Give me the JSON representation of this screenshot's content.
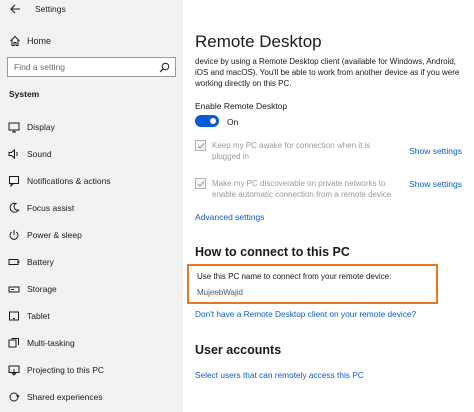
{
  "window": {
    "title": "Settings"
  },
  "sidebar": {
    "home_label": "Home",
    "search_placeholder": "Find a setting",
    "section": "System",
    "items": [
      {
        "label": "Display",
        "icon": "display-icon"
      },
      {
        "label": "Sound",
        "icon": "sound-icon"
      },
      {
        "label": "Notifications & actions",
        "icon": "notifications-icon"
      },
      {
        "label": "Focus assist",
        "icon": "focus-assist-icon"
      },
      {
        "label": "Power & sleep",
        "icon": "power-icon"
      },
      {
        "label": "Battery",
        "icon": "battery-icon"
      },
      {
        "label": "Storage",
        "icon": "storage-icon"
      },
      {
        "label": "Tablet",
        "icon": "tablet-icon"
      },
      {
        "label": "Multi-tasking",
        "icon": "multitasking-icon"
      },
      {
        "label": "Projecting to this PC",
        "icon": "projecting-icon"
      },
      {
        "label": "Shared experiences",
        "icon": "shared-experiences-icon"
      }
    ]
  },
  "main": {
    "title": "Remote Desktop",
    "description": "device by using a Remote Desktop client (available for Windows, Android, iOS and macOS). You'll be able to work from another device as if you were working directly on this PC.",
    "enable_label": "Enable Remote Desktop",
    "toggle_state": "On",
    "toggle_on": true,
    "checkbox1_text": "Keep my PC awake for connection when it is plugged in",
    "checkbox2_text": "Make my PC discoverable on private networks to enable automatic connection from a remote device",
    "show_settings": "Show settings",
    "advanced_settings": "Advanced settings",
    "how_to_connect_heading": "How to connect to this PC",
    "callout_text": "Use this PC name to connect from your remote device:",
    "pc_name": "MujeebWajid",
    "no_client_link": "Don't have a Remote Desktop client on your remote device?",
    "user_accounts_heading": "User accounts",
    "select_users_link": "Select users that can remotely access this PC"
  },
  "colors": {
    "accent": "#0a5bd3",
    "callout_border": "#e87722",
    "sidebar_bg": "#f2f2f2"
  }
}
